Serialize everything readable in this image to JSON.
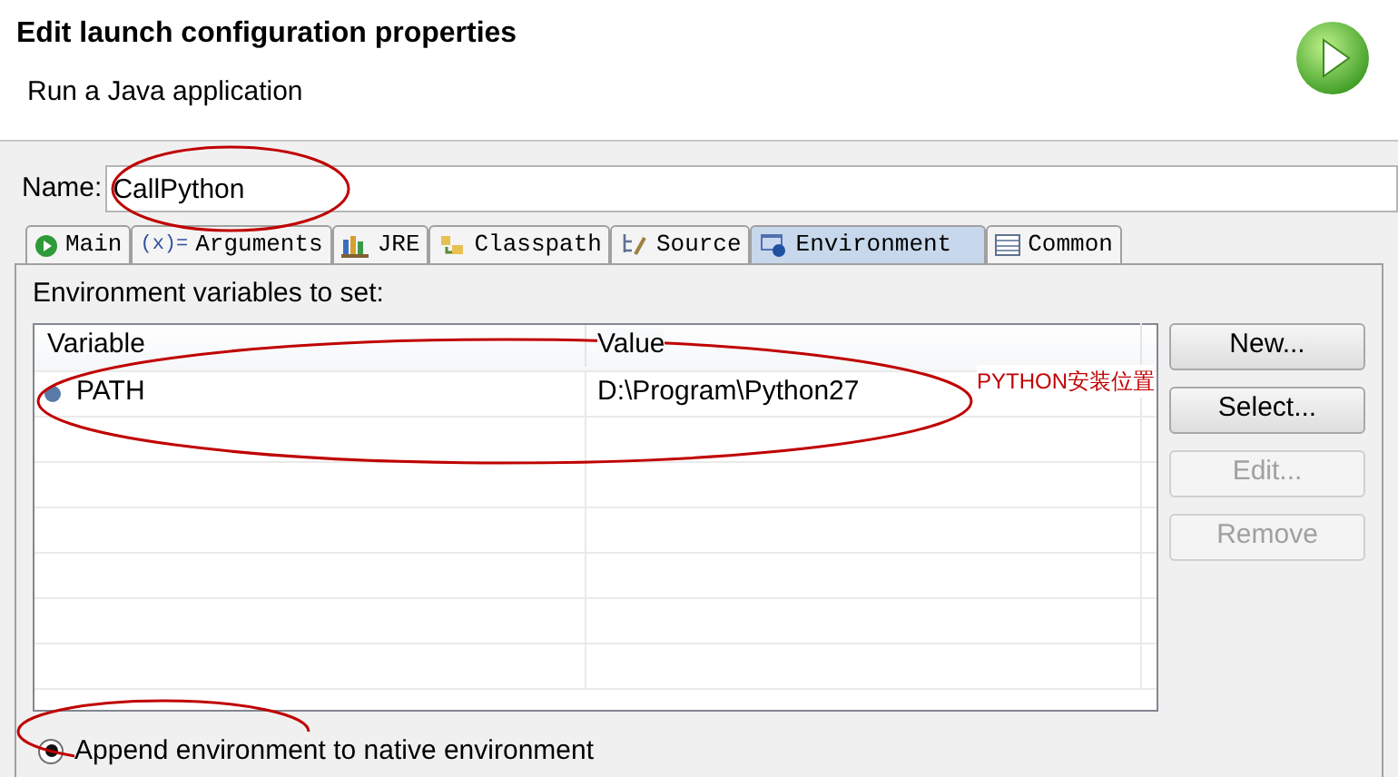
{
  "header": {
    "title": "Edit launch configuration properties",
    "subtitle": "Run a Java application"
  },
  "name_field": {
    "label": "Name:",
    "value": "CallPython"
  },
  "tabs": [
    {
      "label": "Main",
      "kind": "main",
      "selected": false
    },
    {
      "label": "Arguments",
      "kind": "arguments",
      "icon_text": "(x)=",
      "selected": false
    },
    {
      "label": "JRE",
      "kind": "jre",
      "selected": false
    },
    {
      "label": "Classpath",
      "kind": "classpath",
      "selected": false
    },
    {
      "label": "Source",
      "kind": "source",
      "selected": false
    },
    {
      "label": "Environment",
      "kind": "environment",
      "selected": true
    },
    {
      "label": "Common",
      "kind": "common",
      "selected": false
    }
  ],
  "section_label": "Environment variables to set:",
  "table": {
    "columns": [
      "Variable",
      "Value"
    ],
    "rows": [
      {
        "variable": "PATH",
        "value": "D:\\Program\\Python27"
      }
    ]
  },
  "annotation": "PYTHON安装位置",
  "buttons": [
    {
      "label": "New...",
      "disabled": false
    },
    {
      "label": "Select...",
      "disabled": false
    },
    {
      "label": "Edit...",
      "disabled": true
    },
    {
      "label": "Remove",
      "disabled": true
    }
  ],
  "radio": {
    "label": "Append environment to native environment",
    "selected": true
  }
}
